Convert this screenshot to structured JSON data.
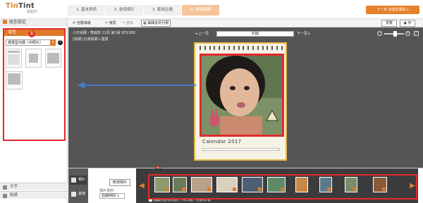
{
  "header": {
    "logo": "TinTint",
    "logo_sub": "點點印",
    "steps": [
      "1. 基本資訊",
      "2. 新增相片",
      "3. 套用主題",
      "4. 開始編輯"
    ],
    "next_button": "下一步  完成並購買 ▸"
  },
  "left_panel": {
    "section_title": "版型設定",
    "tab_label": "版型",
    "badge": "1",
    "layout_select": "標準型日曆（中照片）",
    "help": "?",
    "bottom_tabs": [
      "文字",
      "貼紙"
    ]
  },
  "toolbar": {
    "auto_fill": "自動填版",
    "undo": "復原",
    "redo": "重做",
    "edit_month": "編輯此的月曆",
    "preview": "預覽",
    "save": "存"
  },
  "canvas": {
    "info_line1": "小日桌曆・雙面款 12頁 第1版 NT$388",
    "info_line2": "[假期] 台灣假期＋農曆",
    "prev": "◂ 上一頁",
    "page": "封面",
    "next": "下一頁 ▸",
    "calendar_title": "Calendar 2017"
  },
  "bottom": {
    "tabs": [
      "相片",
      "其他"
    ],
    "badge": "2",
    "add_photo": "新增相片",
    "sort_label": "相片排序：",
    "sort_value": "拍攝時間 ∨",
    "hide_used": "隱藏已使用的相片，共12張，已使用1張"
  },
  "colors": {
    "accent": "#e07a2b",
    "highlight": "#e02b2b",
    "canvas_bg": "#555555",
    "arrow": "#4a7cc9"
  }
}
